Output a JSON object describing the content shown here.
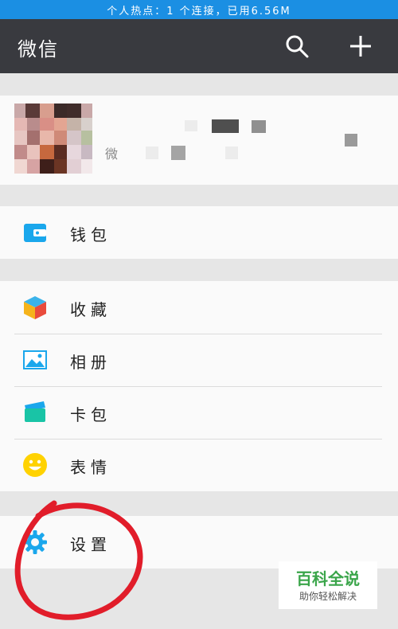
{
  "status_bar": {
    "text": "个人热点：1 个连接，已用6.56M"
  },
  "app_bar": {
    "title": "微信",
    "search_icon": "search-icon",
    "add_icon": "plus-icon"
  },
  "profile": {
    "id_prefix": "微"
  },
  "menu_groups": [
    [
      {
        "label": "钱包",
        "icon": "wallet-icon",
        "color": "#1aa7ec"
      }
    ],
    [
      {
        "label": "收藏",
        "icon": "cube-icon",
        "color": "#f5b31b"
      },
      {
        "label": "相册",
        "icon": "photo-icon",
        "color": "#1aa7ec"
      },
      {
        "label": "卡包",
        "icon": "card-icon",
        "color": "#1aa7ec"
      },
      {
        "label": "表情",
        "icon": "smiley-icon",
        "color": "#ffd200"
      }
    ],
    [
      {
        "label": "设置",
        "icon": "gear-icon",
        "color": "#1aa7ec"
      }
    ]
  ],
  "watermark": {
    "title": "百科全说",
    "subtitle": "助你轻松解决"
  },
  "colors": {
    "app_bar": "#393a3f",
    "status_bar": "#1b8fe3",
    "annotation": "#e11d2a"
  }
}
